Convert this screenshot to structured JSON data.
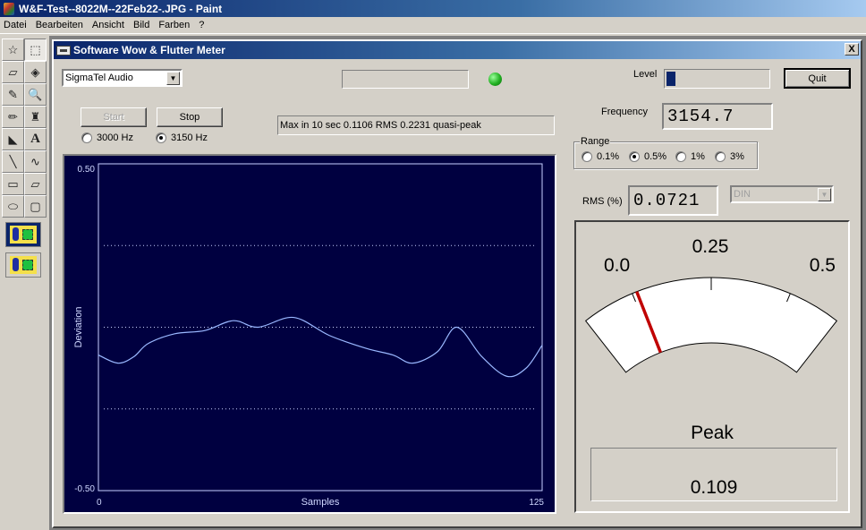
{
  "window": {
    "title": "W&F-Test--8022M--22Feb22-.JPG - Paint",
    "menu": [
      "Datei",
      "Bearbeiten",
      "Ansicht",
      "Bild",
      "Farben",
      "?"
    ]
  },
  "toolbox": {
    "tools": [
      {
        "name": "free-select",
        "glyph": "☆"
      },
      {
        "name": "rect-select",
        "glyph": "⬚"
      },
      {
        "name": "eraser",
        "glyph": "▱"
      },
      {
        "name": "fill",
        "glyph": "◈"
      },
      {
        "name": "color-picker",
        "glyph": "✎"
      },
      {
        "name": "magnifier",
        "glyph": "🔍"
      },
      {
        "name": "pencil",
        "glyph": "✏"
      },
      {
        "name": "brush",
        "glyph": "♜"
      },
      {
        "name": "airbrush",
        "glyph": "◣"
      },
      {
        "name": "text",
        "glyph": "A"
      },
      {
        "name": "line",
        "glyph": "╲"
      },
      {
        "name": "curve",
        "glyph": "∿"
      },
      {
        "name": "rectangle",
        "glyph": "▭"
      },
      {
        "name": "polygon",
        "glyph": "▱"
      },
      {
        "name": "ellipse",
        "glyph": "⬭"
      },
      {
        "name": "rounded-rect",
        "glyph": "▢"
      }
    ],
    "active_tool": "rect-select"
  },
  "dialog": {
    "title": "Software Wow & Flutter Meter",
    "close_label": "X",
    "device_select": "SigmaTel Audio",
    "status_box": "",
    "led_color": "#22b022",
    "start_label": "Start",
    "stop_label": "Stop",
    "freq_options": [
      {
        "label": "3000 Hz",
        "selected": false
      },
      {
        "label": "3150 Hz",
        "selected": true
      }
    ],
    "message": "Max in 10 sec 0.1106 RMS 0.2231 quasi-peak",
    "level_label": "Level",
    "level_fraction": 0.09,
    "quit_label": "Quit",
    "frequency_label": "Frequency",
    "frequency_value": "3154.7",
    "range_label": "Range",
    "range_options": [
      {
        "label": "0.1%",
        "selected": false
      },
      {
        "label": "0.5%",
        "selected": true
      },
      {
        "label": "1%",
        "selected": false
      },
      {
        "label": "3%",
        "selected": false
      }
    ],
    "rms_label": "RMS (%)",
    "rms_value": "0.0721",
    "weighting_select": "DIN",
    "meter": {
      "scale_min": "0.0",
      "scale_mid": "0.25",
      "scale_max": "0.5",
      "min": 0.0,
      "max": 0.5,
      "needle_value": 0.109,
      "needle_color": "#c00000",
      "peak_label": "Peak",
      "peak_value": "0.109"
    }
  },
  "chart_data": {
    "type": "line",
    "title": "",
    "xlabel": "Samples",
    "ylabel": "Deviation",
    "xlim": [
      0,
      125
    ],
    "ylim": [
      -0.5,
      0.5
    ],
    "x_ticks": [
      "0",
      "125"
    ],
    "y_ticks": [
      "0.50",
      "-0.50"
    ],
    "grid_y": [
      0.25,
      0.0,
      -0.25
    ],
    "grid": "dotted horizontal",
    "background": "#000040",
    "line_color": "#9ab8ff",
    "x": [
      0,
      5.5,
      10,
      14,
      21.5,
      30,
      38,
      45,
      55,
      65,
      75.5,
      83,
      88.5,
      95.5,
      101,
      108,
      115,
      120.5,
      125
    ],
    "series": [
      {
        "name": "deviation",
        "values": [
          -0.085,
          -0.11,
          -0.09,
          -0.05,
          -0.02,
          -0.01,
          0.02,
          0.0,
          0.03,
          -0.025,
          -0.065,
          -0.085,
          -0.11,
          -0.075,
          0.0,
          -0.09,
          -0.15,
          -0.125,
          -0.055
        ]
      }
    ]
  }
}
